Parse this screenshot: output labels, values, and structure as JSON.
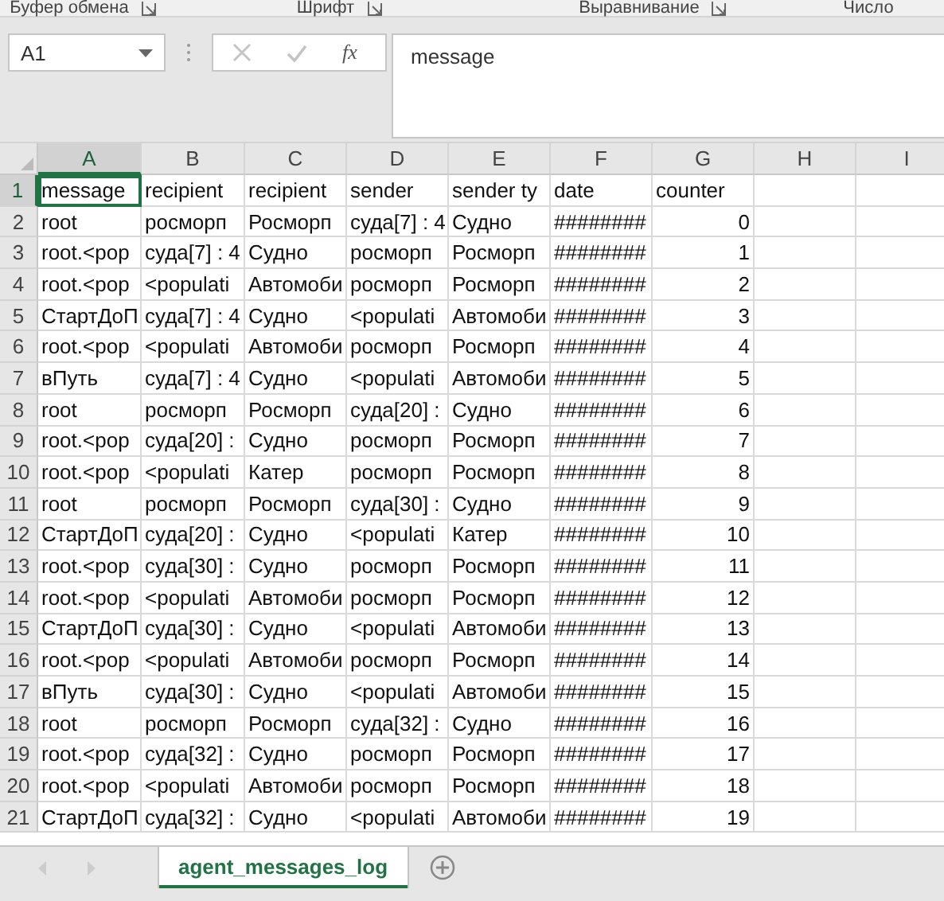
{
  "ribbon_groups": [
    "Буфер обмена",
    "Шрифт",
    "Выравнивание",
    "Число"
  ],
  "formula_bar": {
    "name_box": "A1",
    "function_button": "fx",
    "value": "message",
    "cancel_disabled": true,
    "enter_disabled": true
  },
  "columns": [
    {
      "label": "A",
      "selected": true
    },
    {
      "label": "B",
      "selected": false
    },
    {
      "label": "C",
      "selected": false
    },
    {
      "label": "D",
      "selected": false
    },
    {
      "label": "E",
      "selected": false
    },
    {
      "label": "F",
      "selected": false
    },
    {
      "label": "G",
      "selected": false
    },
    {
      "label": "H",
      "selected": false
    },
    {
      "label": "I",
      "selected": false
    }
  ],
  "rows": [
    {
      "number": "1",
      "selected": true,
      "cells": [
        "message",
        "recipient",
        "recipient",
        "sender",
        "sender ty",
        "date",
        "counter"
      ]
    },
    {
      "number": "2",
      "selected": false,
      "cells": [
        "root",
        "росморп",
        "Росморп",
        "суда[7] : 4",
        "Судно",
        "########",
        "0"
      ]
    },
    {
      "number": "3",
      "selected": false,
      "cells": [
        "root.<pop",
        "суда[7] : 4",
        "Судно",
        "росморп",
        "Росморп",
        "########",
        "1"
      ]
    },
    {
      "number": "4",
      "selected": false,
      "cells": [
        "root.<pop",
        "<populati",
        "Автомоби",
        "росморп",
        "Росморп",
        "########",
        "2"
      ]
    },
    {
      "number": "5",
      "selected": false,
      "cells": [
        "СтартДоП",
        "суда[7] : 4",
        "Судно",
        "<populati",
        "Автомоби",
        "########",
        "3"
      ]
    },
    {
      "number": "6",
      "selected": false,
      "cells": [
        "root.<pop",
        "<populati",
        "Автомоби",
        "росморп",
        "Росморп",
        "########",
        "4"
      ]
    },
    {
      "number": "7",
      "selected": false,
      "cells": [
        "вПуть",
        "суда[7] : 4",
        "Судно",
        "<populati",
        "Автомоби",
        "########",
        "5"
      ]
    },
    {
      "number": "8",
      "selected": false,
      "cells": [
        "root",
        "росморп",
        "Росморп",
        "суда[20] :",
        "Судно",
        "########",
        "6"
      ]
    },
    {
      "number": "9",
      "selected": false,
      "cells": [
        "root.<pop",
        "суда[20] :",
        "Судно",
        "росморп",
        "Росморп",
        "########",
        "7"
      ]
    },
    {
      "number": "10",
      "selected": false,
      "cells": [
        "root.<pop",
        "<populati",
        "Катер",
        "росморп",
        "Росморп",
        "########",
        "8"
      ]
    },
    {
      "number": "11",
      "selected": false,
      "cells": [
        "root",
        "росморп",
        "Росморп",
        "суда[30] :",
        "Судно",
        "########",
        "9"
      ]
    },
    {
      "number": "12",
      "selected": false,
      "cells": [
        "СтартДоП",
        "суда[20] :",
        "Судно",
        "<populati",
        "Катер",
        "########",
        "10"
      ]
    },
    {
      "number": "13",
      "selected": false,
      "cells": [
        "root.<pop",
        "суда[30] :",
        "Судно",
        "росморп",
        "Росморп",
        "########",
        "11"
      ]
    },
    {
      "number": "14",
      "selected": false,
      "cells": [
        "root.<pop",
        "<populati",
        "Автомоби",
        "росморп",
        "Росморп",
        "########",
        "12"
      ]
    },
    {
      "number": "15",
      "selected": false,
      "cells": [
        "СтартДоП",
        "суда[30] :",
        "Судно",
        "<populati",
        "Автомоби",
        "########",
        "13"
      ]
    },
    {
      "number": "16",
      "selected": false,
      "cells": [
        "root.<pop",
        "<populati",
        "Автомоби",
        "росморп",
        "Росморп",
        "########",
        "14"
      ]
    },
    {
      "number": "17",
      "selected": false,
      "cells": [
        "вПуть",
        "суда[30] :",
        "Судно",
        "<populati",
        "Автомоби",
        "########",
        "15"
      ]
    },
    {
      "number": "18",
      "selected": false,
      "cells": [
        "root",
        "росморп",
        "Росморп",
        "суда[32] :",
        "Судно",
        "########",
        "16"
      ]
    },
    {
      "number": "19",
      "selected": false,
      "cells": [
        "root.<pop",
        "суда[32] :",
        "Судно",
        "росморп",
        "Росморп",
        "########",
        "17"
      ]
    },
    {
      "number": "20",
      "selected": false,
      "cells": [
        "root.<pop",
        "<populati",
        "Автомоби",
        "росморп",
        "Росморп",
        "########",
        "18"
      ]
    },
    {
      "number": "21",
      "selected": false,
      "cells": [
        "СтартДоП",
        "суда[32] :",
        "Судно",
        "<populati",
        "Автомоби",
        "########",
        "19"
      ]
    }
  ],
  "sheet_tabs": [
    {
      "label": "agent_messages_log",
      "selected": true
    }
  ]
}
